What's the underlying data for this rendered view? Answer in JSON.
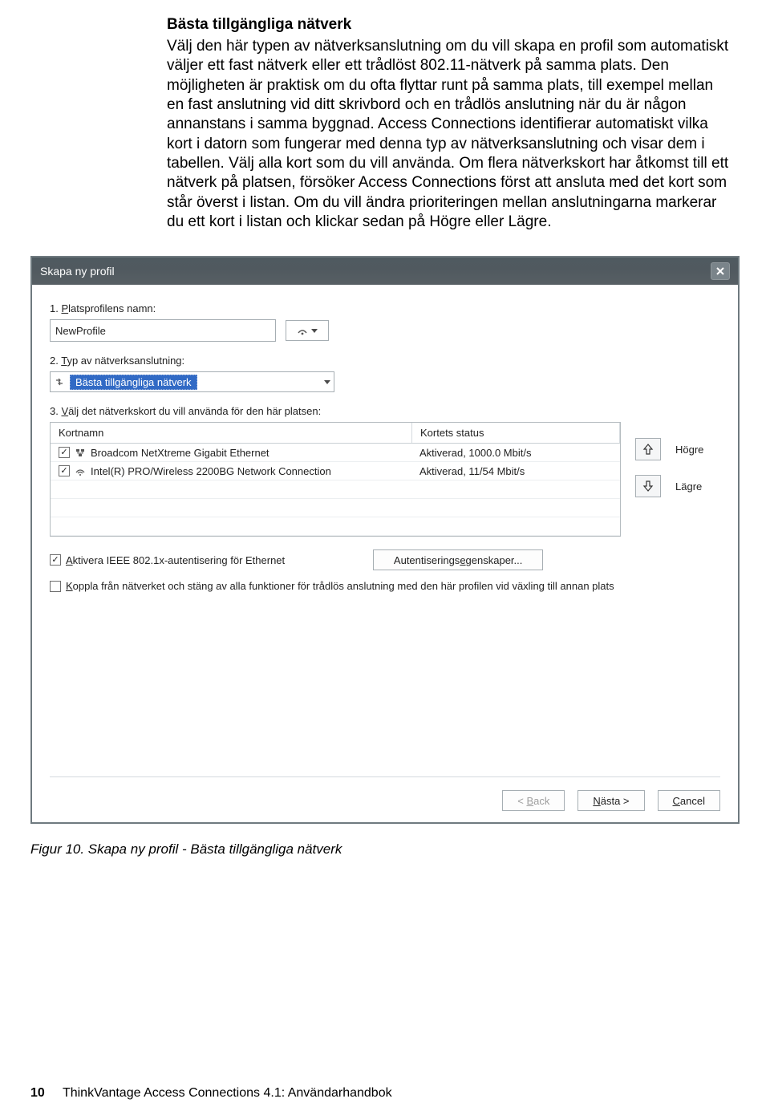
{
  "doc": {
    "heading": "Bästa tillgängliga nätverk",
    "body": "Välj den här typen av nätverksanslutning om du vill skapa en profil som automatiskt väljer ett fast nätverk eller ett trådlöst 802.11-nätverk på samma plats. Den möjligheten är praktisk om du ofta flyttar runt på samma plats, till exempel mellan en fast anslutning vid ditt skrivbord och en trådlös anslutning när du är någon annanstans i samma byggnad. Access Connections identifierar automatiskt vilka kort i datorn som fungerar med denna typ av nätverksanslutning och visar dem i tabellen. Välj alla kort som du vill använda. Om flera nätverkskort har åtkomst till ett nätverk på platsen, försöker Access Connections först att ansluta med det kort som står överst i listan. Om du vill ändra prioriteringen mellan anslutningarna markerar du ett kort i listan och klickar sedan på Högre eller Lägre."
  },
  "dialog": {
    "title": "Skapa ny profil",
    "step1_pre": "1. ",
    "step1_u": "P",
    "step1_post": "latsprofilens namn:",
    "profile_name": "NewProfile",
    "step2_pre": "2. ",
    "step2_u": "T",
    "step2_post": "yp av nätverksanslutning:",
    "conn_type": "Bästa tillgängliga nätverk",
    "step3_pre": "3. ",
    "step3_u": "V",
    "step3_post": "älj det nätverkskort du vill använda för den här platsen:",
    "table": {
      "col1": "Kortnamn",
      "col2": "Kortets status",
      "rows": [
        {
          "checked": true,
          "icon": "wired",
          "name": "Broadcom NetXtreme Gigabit Ethernet",
          "status": "Aktiverad, 1000.0 Mbit/s"
        },
        {
          "checked": true,
          "icon": "wireless",
          "name": "Intel(R) PRO/Wireless 2200BG Network Connection",
          "status": "Aktiverad, 11/54 Mbit/s"
        }
      ]
    },
    "higher": "Högre",
    "lower": "Lägre",
    "ieee_pre": "",
    "ieee_u": "A",
    "ieee_post": "ktivera IEEE 802.1x-autentisering för Ethernet",
    "auth_pre": "Autentiserings",
    "auth_u": "e",
    "auth_post": "genskaper...",
    "disconnect_pre": "",
    "disconnect_u": "K",
    "disconnect_post": "oppla från nätverket och stäng av alla funktioner för trådlös anslutning med den här profilen vid växling till annan plats",
    "back_pre": "< ",
    "back_u": "B",
    "back_post": "ack",
    "next_u": "N",
    "next_post": "ästa >",
    "cancel_u": "C",
    "cancel_post": "ancel"
  },
  "caption": "Figur 10. Skapa ny profil - Bästa tillgängliga nätverk",
  "footer": {
    "page": "10",
    "title": "ThinkVantage Access Connections 4.1: Användarhandbok"
  }
}
